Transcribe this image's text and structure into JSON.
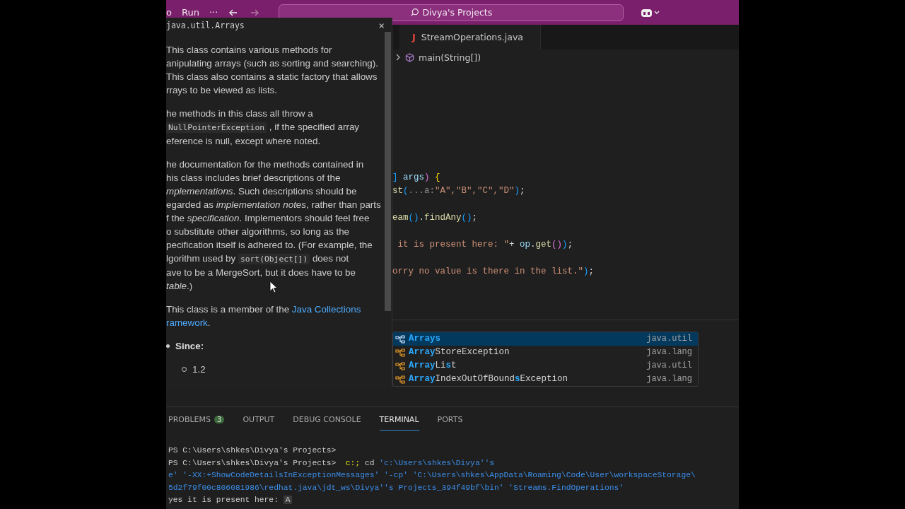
{
  "title_bar": {
    "menu": [
      "o",
      "Run",
      "···"
    ],
    "search": "Divya's Projects"
  },
  "hover_doc": {
    "title": "java.util.Arrays",
    "close": "×",
    "paragraphs": [
      [
        [
          {
            "kind": "text",
            "text": "This class contains various methods for"
          }
        ],
        [
          {
            "kind": "text",
            "text": "anipulating arrays (such as sorting and searching)."
          }
        ],
        [
          {
            "kind": "text",
            "text": "This class also contains a static factory that allows"
          }
        ],
        [
          {
            "kind": "text",
            "text": "rrays to be viewed as lists."
          }
        ]
      ],
      [
        [
          {
            "kind": "text",
            "text": "he methods in this class all throw a"
          }
        ],
        [
          {
            "kind": "code",
            "text": "NullPointerException"
          },
          {
            "kind": "text",
            "text": " , if the specified array"
          }
        ],
        [
          {
            "kind": "text",
            "text": "eference is null, except where noted."
          }
        ]
      ],
      [
        [
          {
            "kind": "text",
            "text": "he documentation for the methods contained in"
          }
        ],
        [
          {
            "kind": "text",
            "text": "his class includes brief descriptions of the"
          }
        ],
        [
          {
            "kind": "italic",
            "text": "mplementations"
          },
          {
            "kind": "text",
            "text": ". Such descriptions should be"
          }
        ],
        [
          {
            "kind": "text",
            "text": "egarded as "
          },
          {
            "kind": "italic",
            "text": "implementation notes"
          },
          {
            "kind": "text",
            "text": ", rather than parts"
          }
        ],
        [
          {
            "kind": "text",
            "text": "f the "
          },
          {
            "kind": "italic",
            "text": "specification"
          },
          {
            "kind": "text",
            "text": ". Implementors should feel free"
          }
        ],
        [
          {
            "kind": "text",
            "text": "o substitute other algorithms, so long as the"
          }
        ],
        [
          {
            "kind": "text",
            "text": "pecification itself is adhered to. (For example, the"
          }
        ],
        [
          {
            "kind": "text",
            "text": "lgorithm used by "
          },
          {
            "kind": "code",
            "text": "sort(Object[])"
          },
          {
            "kind": "text",
            "text": " does not"
          }
        ],
        [
          {
            "kind": "text",
            "text": "ave to be a MergeSort, but it does have to be"
          }
        ],
        [
          {
            "kind": "italic",
            "text": "table"
          },
          {
            "kind": "text",
            "text": ".)"
          }
        ]
      ],
      [
        [
          {
            "kind": "text",
            "text": "This class is a member of the "
          },
          {
            "kind": "link",
            "text": "Java Collections"
          }
        ],
        [
          {
            "kind": "link",
            "text": "ramework"
          },
          {
            "kind": "text",
            "text": "."
          }
        ]
      ]
    ],
    "since_label": "Since:",
    "since_value": "1.2"
  },
  "editor": {
    "tab": {
      "icon": "J",
      "label": "StreamOperations.java"
    },
    "breadcrumb": "main(String[])",
    "lines": [
      {
        "kind": "code",
        "tokens": [
          {
            "kind": "bracket",
            "text": "]"
          },
          {
            "kind": "var",
            "text": " args"
          },
          {
            "kind": "paren",
            "text": ")"
          },
          {
            "kind": "brace",
            "text": " {"
          }
        ]
      },
      {
        "kind": "code",
        "tokens": [
          {
            "kind": "fn",
            "text": "st"
          },
          {
            "kind": "bracket",
            "text": "("
          },
          {
            "kind": "hint",
            "text": "...a:"
          },
          {
            "kind": "string",
            "text": "\"A\",\"B\",\"C\",\"D\""
          },
          {
            "kind": "bracket",
            "text": ")"
          },
          {
            "kind": "plain",
            "text": ";"
          }
        ]
      },
      {
        "kind": "blank"
      },
      {
        "kind": "code",
        "tokens": [
          {
            "kind": "fn",
            "text": "eam"
          },
          {
            "kind": "bracket",
            "text": "()"
          },
          {
            "kind": "plain",
            "text": "."
          },
          {
            "kind": "fn",
            "text": "findAny"
          },
          {
            "kind": "bracket",
            "text": "()"
          },
          {
            "kind": "plain",
            "text": ";"
          }
        ]
      },
      {
        "kind": "blank"
      },
      {
        "kind": "code",
        "tokens": [
          {
            "kind": "string",
            "text": " it is present here: \""
          },
          {
            "kind": "plain",
            "text": "+ "
          },
          {
            "kind": "var",
            "text": "op"
          },
          {
            "kind": "plain",
            "text": "."
          },
          {
            "kind": "fn",
            "text": "get"
          },
          {
            "kind": "paren",
            "text": "()"
          },
          {
            "kind": "bracket",
            "text": ")"
          },
          {
            "kind": "plain",
            "text": ";"
          }
        ]
      },
      {
        "kind": "blank"
      },
      {
        "kind": "code",
        "tokens": [
          {
            "kind": "string",
            "text": "orry no value is there in the list.\""
          },
          {
            "kind": "bracket",
            "text": ")"
          },
          {
            "kind": "plain",
            "text": ";"
          }
        ]
      }
    ],
    "suggestions": [
      {
        "selected": true,
        "segments": [
          {
            "text": "Arrays",
            "match": true
          }
        ],
        "package": "java.util"
      },
      {
        "selected": false,
        "segments": [
          {
            "text": "Array",
            "match": true
          },
          {
            "text": "StoreException",
            "match": false
          }
        ],
        "package": "java.lang"
      },
      {
        "selected": false,
        "segments": [
          {
            "text": "Array",
            "match": true
          },
          {
            "text": "Li",
            "match": false
          },
          {
            "text": "s",
            "match": true
          },
          {
            "text": "t",
            "match": false
          }
        ],
        "package": "java.util"
      },
      {
        "selected": false,
        "segments": [
          {
            "text": "Array",
            "match": true
          },
          {
            "text": "IndexOutOfBound",
            "match": false
          },
          {
            "text": "s",
            "match": true
          },
          {
            "text": "Exception",
            "match": false
          }
        ],
        "package": "java.lang"
      }
    ]
  },
  "panel": {
    "tabs": [
      {
        "label": "PROBLEMS",
        "badge": "3",
        "selected": false
      },
      {
        "label": "OUTPUT",
        "selected": false
      },
      {
        "label": "DEBUG CONSOLE",
        "selected": false
      },
      {
        "label": "TERMINAL",
        "selected": true
      },
      {
        "label": "PORTS",
        "selected": false
      }
    ],
    "terminal": [
      [
        {
          "kind": "plain",
          "text": "PS C:\\Users\\shkes\\Divya's Projects>"
        }
      ],
      [
        {
          "kind": "plain",
          "text": "PS C:\\Users\\shkes\\Divya's Projects> "
        },
        {
          "kind": "command",
          "text": " c:; "
        },
        {
          "kind": "plain",
          "text": "cd "
        },
        {
          "kind": "string",
          "text": "'c:\\Users\\shkes\\Divya''s"
        }
      ],
      [
        {
          "kind": "string",
          "text": "e' '-XX:+ShowCodeDetailsInExceptionMessages' '-cp' 'C:\\Users\\shkes\\AppData\\Roaming\\Code\\User\\workspaceStorage\\"
        }
      ],
      [
        {
          "kind": "string",
          "text": "5d2f79f00c806081986\\redhat.java\\jdt_ws\\Divya''s Projects_394f49bf\\bin' 'Streams.FindOperations'"
        }
      ],
      [
        {
          "kind": "plain",
          "text": "yes it is present here: "
        },
        {
          "kind": "output",
          "text": "A"
        }
      ]
    ]
  }
}
